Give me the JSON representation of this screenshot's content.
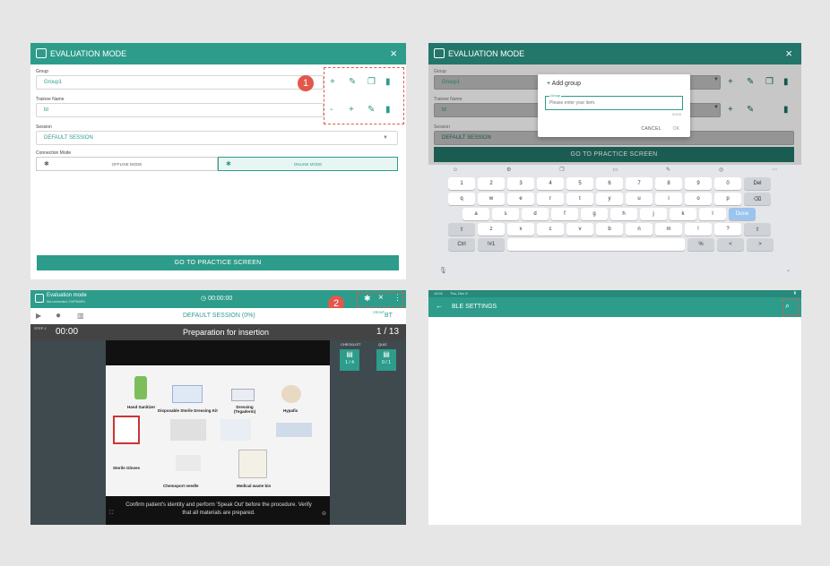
{
  "panel1": {
    "title": "EVALUATION MODE",
    "group_label": "Group",
    "group_value": "Group1",
    "trainee_label": "Trainee Name",
    "trainee_value": "bt",
    "session_label": "Session",
    "session_value": "DEFAULT SESSION",
    "connection_label": "Connection Mode",
    "offline_label": "OFFLINE MODE",
    "online_label": "ONLINE MODE",
    "go_button": "GO TO PRACTICE SCREEN",
    "badge": "1"
  },
  "panel2": {
    "title": "EVALUATION MODE",
    "group_label": "Group",
    "group_value": "Group1",
    "trainee_label": "Trainee Name",
    "trainee_value": "bt",
    "session_label": "Session",
    "session_value": "DEFAULT SESSION",
    "go_button": "GO TO PRACTICE SCREEN",
    "dialog": {
      "title": "Add group",
      "field_label": "Group",
      "placeholder": "Please enter your item.",
      "counter": "0/100",
      "cancel": "CANCEL",
      "ok": "OK"
    },
    "keyboard": {
      "row1": [
        "1",
        "2",
        "3",
        "4",
        "5",
        "6",
        "7",
        "8",
        "9",
        "0",
        "Del"
      ],
      "row2": [
        "q",
        "w",
        "e",
        "r",
        "t",
        "y",
        "u",
        "i",
        "o",
        "p",
        "⌫"
      ],
      "row3": [
        "a",
        "s",
        "d",
        "f",
        "g",
        "h",
        "j",
        "k",
        "l",
        "Done"
      ],
      "row4": [
        "⇧",
        "z",
        "x",
        "c",
        "v",
        "b",
        "n",
        "m",
        "!",
        "?",
        "⇧"
      ],
      "row5": [
        "Ctrl",
        "!#1",
        "",
        "%",
        "<",
        ">"
      ]
    }
  },
  "panel3": {
    "app_title": "Evaluation mode",
    "subtitle": "Not connected: CVIPMARS",
    "timer": "00:00:00",
    "session": "DEFAULT SESSION",
    "session_pct": "(0%)",
    "group_label": "GROUP",
    "group_value": "BT",
    "step_label": "STEP 1",
    "step_time": "00:00",
    "step_title": "Preparation for insertion",
    "step_count": "1 / 13",
    "checklist_label": "CHECKLIST",
    "checklist_value": "1 / 4",
    "quiz_label": "QUIZ",
    "quiz_value": "0 / 1",
    "image_labels": [
      "Hand Sanitizer",
      "Disposable Sterile Dressing Kit",
      "Dressing (Tegaderm)",
      "Hypafix",
      "Sterile Gloves",
      "Chemoport needle",
      "Medical waste bin"
    ],
    "instruction": "Confirm patient's identity and perform 'Speak Out' before the procedure. Verify that all materials are prepared.",
    "badge": "2"
  },
  "panel4": {
    "status_time": "10:01",
    "status_date": "Thu, Dec 5",
    "title": "BLE SETTINGS"
  },
  "colors": {
    "accent": "#2d9c8b",
    "badge": "#e2574c"
  }
}
